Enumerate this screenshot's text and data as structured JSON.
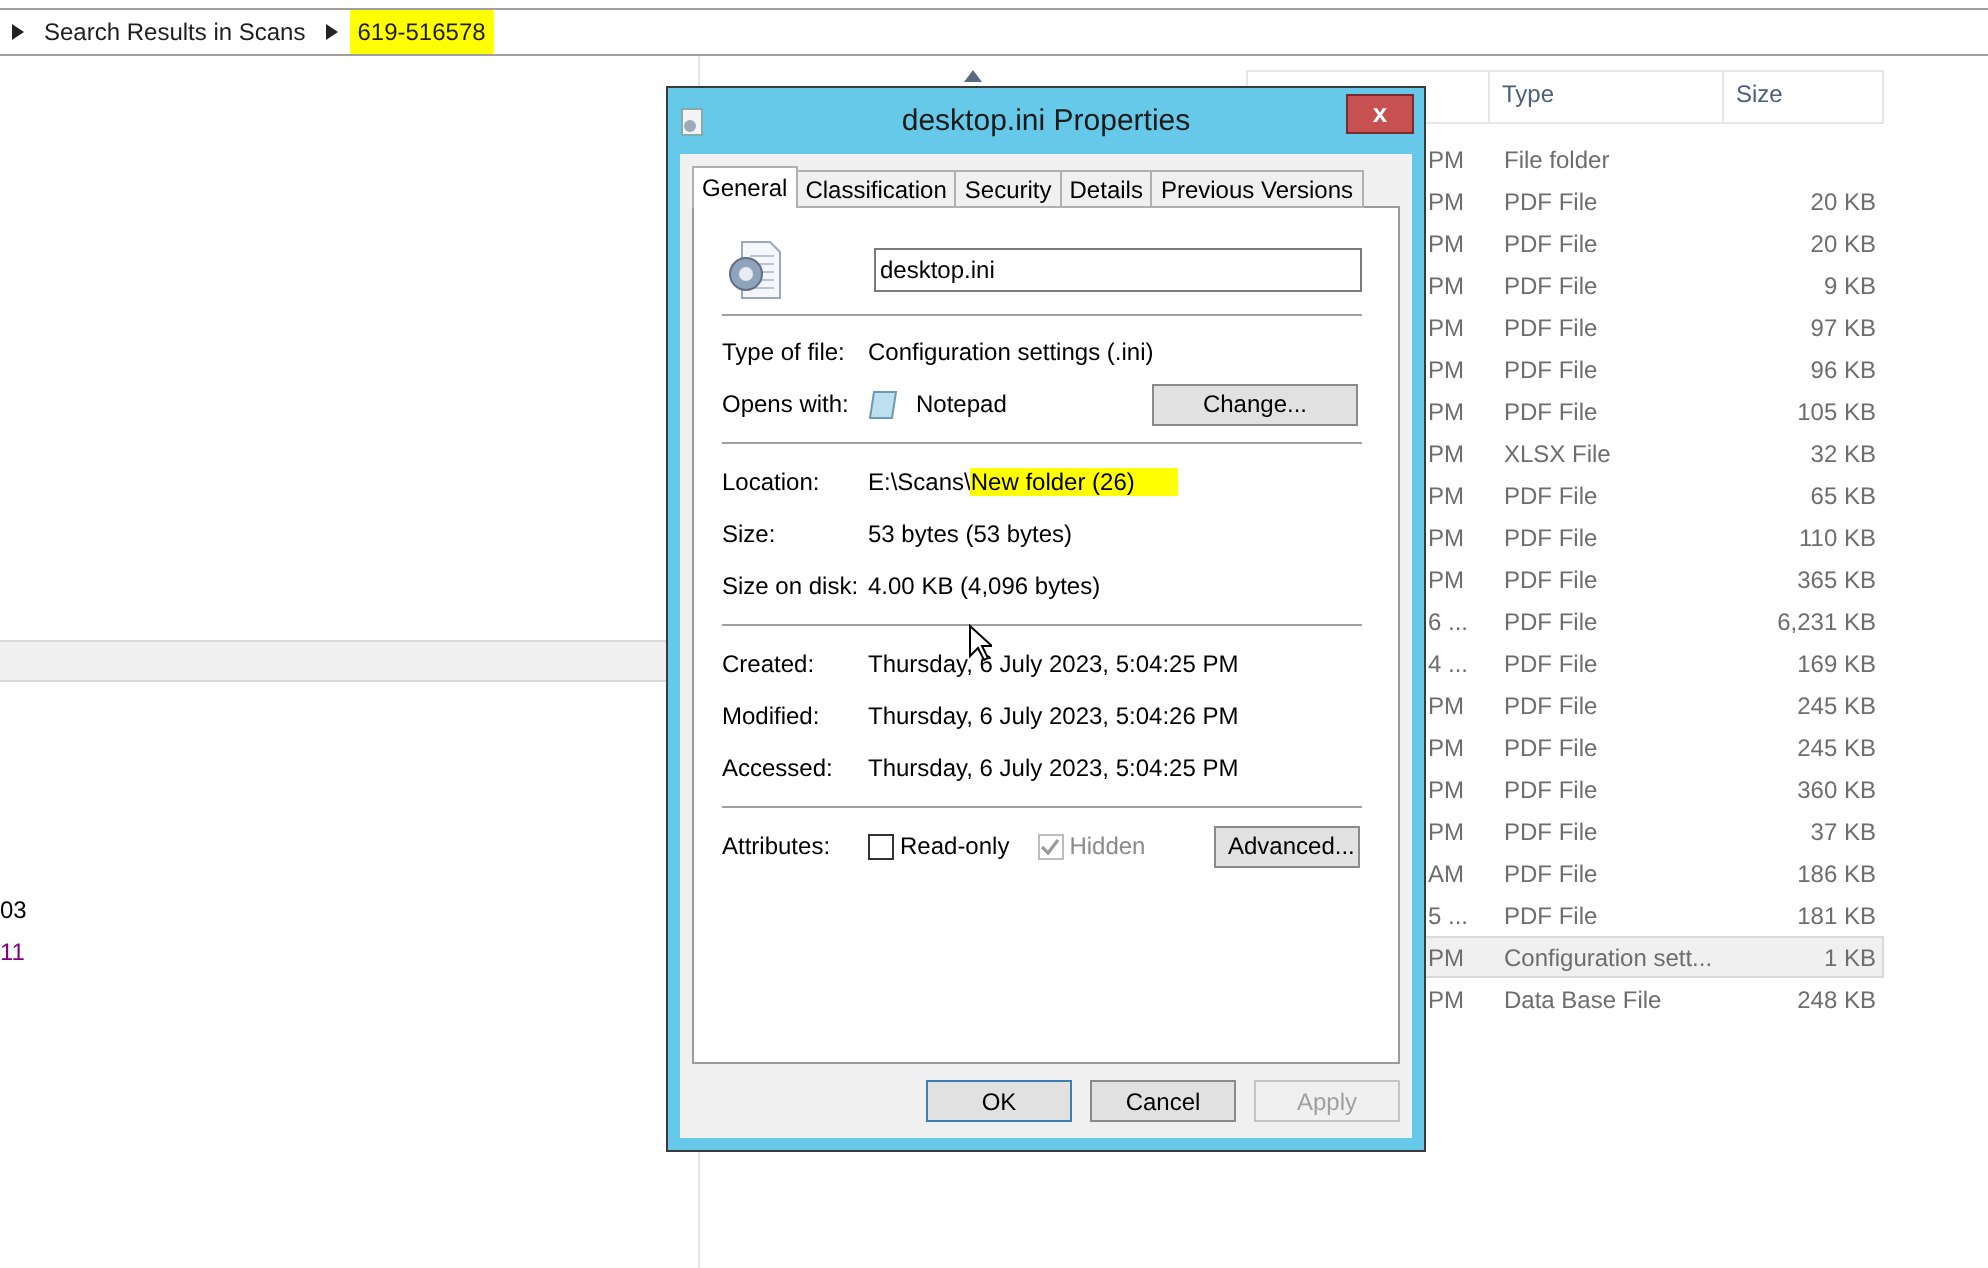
{
  "breadcrumb": {
    "items": [
      {
        "label": "Search Results in Scans",
        "highlighted": false
      },
      {
        "label": "619-516578",
        "highlighted": true
      }
    ]
  },
  "left_pane": {
    "items": [
      {
        "label": "03",
        "visited": false
      },
      {
        "label": "11",
        "visited": true
      }
    ]
  },
  "file_list": {
    "columns": [
      "Type",
      "Size"
    ],
    "rows": [
      {
        "column_1": "PM",
        "type": "File folder",
        "size": "",
        "selected": false
      },
      {
        "column_1": "PM",
        "type": "PDF File",
        "size": "20 KB",
        "selected": false
      },
      {
        "column_1": "PM",
        "type": "PDF File",
        "size": "20 KB",
        "selected": false
      },
      {
        "column_1": "PM",
        "type": "PDF File",
        "size": "9 KB",
        "selected": false
      },
      {
        "column_1": "PM",
        "type": "PDF File",
        "size": "97 KB",
        "selected": false
      },
      {
        "column_1": "PM",
        "type": "PDF File",
        "size": "96 KB",
        "selected": false
      },
      {
        "column_1": "PM",
        "type": "PDF File",
        "size": "105 KB",
        "selected": false
      },
      {
        "column_1": "PM",
        "type": "XLSX File",
        "size": "32 KB",
        "selected": false
      },
      {
        "column_1": "PM",
        "type": "PDF File",
        "size": "65 KB",
        "selected": false
      },
      {
        "column_1": "PM",
        "type": "PDF File",
        "size": "110 KB",
        "selected": false
      },
      {
        "column_1": "PM",
        "type": "PDF File",
        "size": "365 KB",
        "selected": false
      },
      {
        "column_1": "6 ...",
        "type": "PDF File",
        "size": "6,231 KB",
        "selected": false
      },
      {
        "column_1": "4 ...",
        "type": "PDF File",
        "size": "169 KB",
        "selected": false
      },
      {
        "column_1": "PM",
        "type": "PDF File",
        "size": "245 KB",
        "selected": false
      },
      {
        "column_1": "PM",
        "type": "PDF File",
        "size": "245 KB",
        "selected": false
      },
      {
        "column_1": "PM",
        "type": "PDF File",
        "size": "360 KB",
        "selected": false
      },
      {
        "column_1": "PM",
        "type": "PDF File",
        "size": "37 KB",
        "selected": false
      },
      {
        "column_1": "AM",
        "type": "PDF File",
        "size": "186 KB",
        "selected": false
      },
      {
        "column_1": "5 ...",
        "type": "PDF File",
        "size": "181 KB",
        "selected": false
      },
      {
        "column_1": "PM",
        "type": "Configuration sett...",
        "size": "1 KB",
        "selected": true
      },
      {
        "column_1": "PM",
        "type": "Data Base File",
        "size": "248 KB",
        "selected": false
      }
    ]
  },
  "dialog": {
    "title": "desktop.ini Properties",
    "close": "x",
    "tabs": [
      {
        "label": "General",
        "selected": true
      },
      {
        "label": "Classification",
        "selected": false
      },
      {
        "label": "Security",
        "selected": false
      },
      {
        "label": "Details",
        "selected": false
      },
      {
        "label": "Previous Versions",
        "selected": false
      }
    ],
    "file_name": "desktop.ini",
    "type_of_file": {
      "label": "Type of file:",
      "value": "Configuration settings (.ini)"
    },
    "opens_with": {
      "label": "Opens with:",
      "value": "Notepad",
      "button": "Change..."
    },
    "location": {
      "label": "Location:",
      "value": "E:\\Scans\\",
      "highlighted_value": "New folder (26)"
    },
    "size": {
      "label": "Size:",
      "value": "53 bytes (53 bytes)"
    },
    "size_on_disk": {
      "label": "Size on disk:",
      "value": "4.00 KB (4,096 bytes)"
    },
    "created": {
      "label": "Created:",
      "value": "Thursday, 6 July 2023, 5:04:25 PM"
    },
    "modified": {
      "label": "Modified:",
      "value": "Thursday, 6 July 2023, 5:04:26 PM"
    },
    "accessed": {
      "label": "Accessed:",
      "value": "Thursday, 6 July 2023, 5:04:25 PM"
    },
    "attributes": {
      "label": "Attributes:",
      "options": [
        {
          "label": "Read-only",
          "checked": false,
          "disabled": false
        },
        {
          "label": "Hidden",
          "checked": true,
          "disabled": true
        }
      ],
      "button": "Advanced..."
    },
    "buttons": [
      {
        "label": "OK",
        "disabled": false,
        "default": true
      },
      {
        "label": "Cancel",
        "disabled": false,
        "default": false
      },
      {
        "label": "Apply",
        "disabled": true,
        "default": false
      }
    ]
  }
}
